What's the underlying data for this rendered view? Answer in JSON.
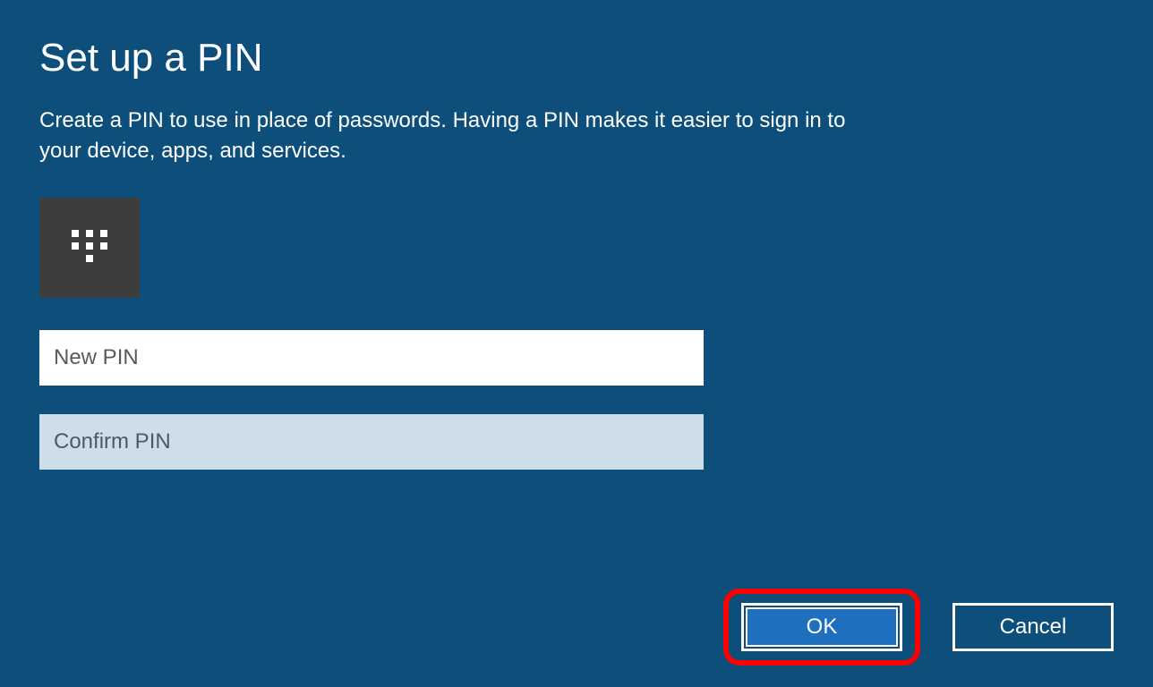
{
  "title": "Set up a PIN",
  "description": "Create a PIN to use in place of passwords. Having a PIN makes it easier to sign in to your device, apps, and services.",
  "inputs": {
    "new_pin": {
      "placeholder": "New PIN",
      "value": ""
    },
    "confirm_pin": {
      "placeholder": "Confirm PIN",
      "value": ""
    }
  },
  "buttons": {
    "ok": "OK",
    "cancel": "Cancel"
  },
  "icon": "keypad-icon"
}
